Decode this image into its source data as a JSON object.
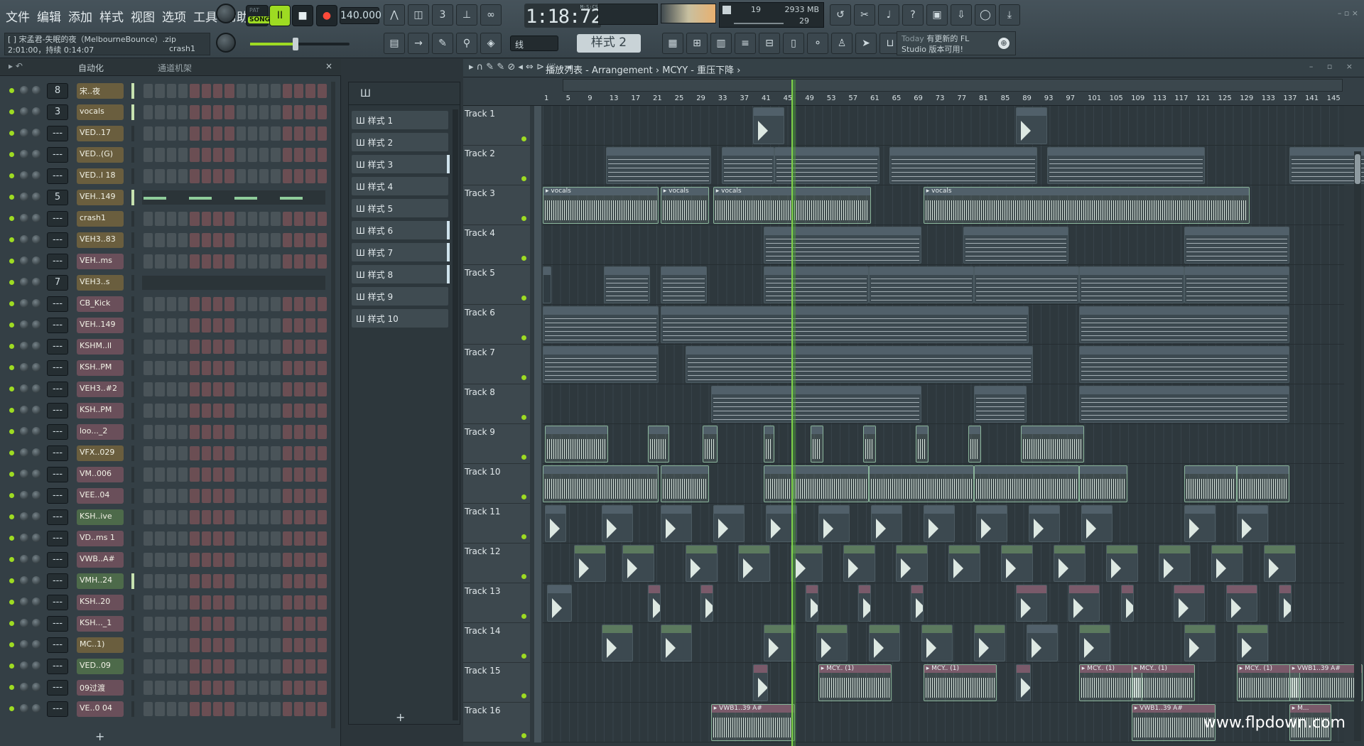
{
  "menu": [
    "文件",
    "编辑",
    "添加",
    "样式",
    "视图",
    "选项",
    "工具",
    "帮助"
  ],
  "transport": {
    "pat": "PAT",
    "song": "SONG",
    "pause": "II",
    "stop": "■",
    "rec": "●",
    "tempo": "140.000"
  },
  "clock": {
    "time": "1:18:72",
    "unit": "M:S:CS"
  },
  "cpu": {
    "a": "19",
    "b": "2933 MB",
    "c": "29"
  },
  "song_info": {
    "line1": "[ ] 宋孟君-失眠的夜（MelbourneBounce）.zip",
    "line2": "2:01:00，持续 0:14:07",
    "crash": "crash1"
  },
  "snap": "线",
  "pattern_selector": "样式 2",
  "news": {
    "today": "Today",
    "line1": "有更新的 FL",
    "line2": "Studio 版本可用!",
    "globe": "⊕"
  },
  "window_controls": "– ▫ ×",
  "channel_rack": {
    "automation": "自动化",
    "mixer": "通道机架",
    "close": "×",
    "misc": "▸ ↶",
    "channels": [
      {
        "mix": "8",
        "name": "宋..夜",
        "color": "gold",
        "grip": true
      },
      {
        "mix": "3",
        "name": "vocals",
        "color": "gold",
        "grip": true
      },
      {
        "mix": "---",
        "name": "VED..17",
        "color": "gold",
        "grip": false
      },
      {
        "mix": "---",
        "name": "VED..(G)",
        "color": "gold",
        "grip": false
      },
      {
        "mix": "---",
        "name": "VED..l 18",
        "color": "gold",
        "grip": false
      },
      {
        "mix": "5",
        "name": "VEH..149",
        "color": "gold",
        "grip": true,
        "long": true
      },
      {
        "mix": "---",
        "name": "crash1",
        "color": "gold",
        "grip": false
      },
      {
        "mix": "---",
        "name": "VEH3..83",
        "color": "gold",
        "grip": false
      },
      {
        "mix": "---",
        "name": "VEH..ms",
        "color": "pink",
        "grip": false
      },
      {
        "mix": "7",
        "name": "VEH3..s",
        "color": "gold",
        "grip": false,
        "empty": true
      },
      {
        "mix": "---",
        "name": "CB_Kick",
        "color": "pink",
        "grip": false
      },
      {
        "mix": "---",
        "name": "VEH..149",
        "color": "pink",
        "grip": false
      },
      {
        "mix": "---",
        "name": "KSHM..ll",
        "color": "pink",
        "grip": false
      },
      {
        "mix": "---",
        "name": "KSH..PM",
        "color": "pink",
        "grip": false
      },
      {
        "mix": "---",
        "name": "VEH3..#2",
        "color": "pink",
        "grip": false
      },
      {
        "mix": "---",
        "name": "KSH..PM",
        "color": "pink",
        "grip": false
      },
      {
        "mix": "---",
        "name": "loo..._2",
        "color": "pink",
        "grip": false
      },
      {
        "mix": "---",
        "name": "VFX..029",
        "color": "gold",
        "grip": false
      },
      {
        "mix": "---",
        "name": "VM..006",
        "color": "pink",
        "grip": false
      },
      {
        "mix": "---",
        "name": "VEE..04",
        "color": "pink",
        "grip": false
      },
      {
        "mix": "---",
        "name": "KSH..ive",
        "color": "green",
        "grip": false
      },
      {
        "mix": "---",
        "name": "VD..ms 1",
        "color": "pink",
        "grip": false
      },
      {
        "mix": "---",
        "name": "VWB..A#",
        "color": "pink",
        "grip": false
      },
      {
        "mix": "---",
        "name": "VMH..24",
        "color": "green",
        "grip": true
      },
      {
        "mix": "---",
        "name": "KSH..20",
        "color": "pink",
        "grip": false
      },
      {
        "mix": "---",
        "name": "KSH..._1",
        "color": "pink",
        "grip": false
      },
      {
        "mix": "---",
        "name": "MC..1)",
        "color": "gold",
        "grip": false
      },
      {
        "mix": "---",
        "name": "VED..09",
        "color": "green",
        "grip": false
      },
      {
        "mix": "---",
        "name": "09过渡",
        "color": "pink",
        "grip": false
      },
      {
        "mix": "---",
        "name": "VE..0 04",
        "color": "pink",
        "grip": false
      }
    ],
    "add": "+"
  },
  "patterns": {
    "head": "Ш",
    "items": [
      "样式 1",
      "样式 2",
      "样式 3",
      "样式 4",
      "样式 5",
      "样式 6",
      "样式 7",
      "样式 8",
      "样式 9",
      "样式 10"
    ],
    "add": "+"
  },
  "playlist": {
    "title": "播放列表 - Arrangement › MCYY - 重压下降 ›",
    "tools": "▸ ∩ ✎ ✎ ⊘ ◂ ⇔ ⊳ ⬚ ⌕ ◂",
    "winbtn": "– ▫ ×",
    "ruler": [
      "1",
      "5",
      "9",
      "13",
      "17",
      "21",
      "25",
      "29",
      "33",
      "37",
      "41",
      "45",
      "49",
      "53",
      "57",
      "61",
      "65",
      "69",
      "73",
      "77",
      "81",
      "85",
      "89",
      "93",
      "97",
      "101",
      "105",
      "109",
      "113",
      "117",
      "121",
      "125",
      "129",
      "133",
      "137",
      "141",
      "145"
    ],
    "tracks": [
      "Track 1",
      "Track 2",
      "Track 3",
      "Track 4",
      "Track 5",
      "Track 6",
      "Track 7",
      "Track 8",
      "Track 9",
      "Track 10",
      "Track 11",
      "Track 12",
      "Track 13",
      "Track 14",
      "Track 15",
      "Track 16"
    ],
    "clip_labels": {
      "vocals": "vocals",
      "mcy": "MCY.. (1)",
      "vwb": "VWB1..39 A#",
      "m": "M..."
    }
  },
  "watermark": "www.flpdown.com"
}
